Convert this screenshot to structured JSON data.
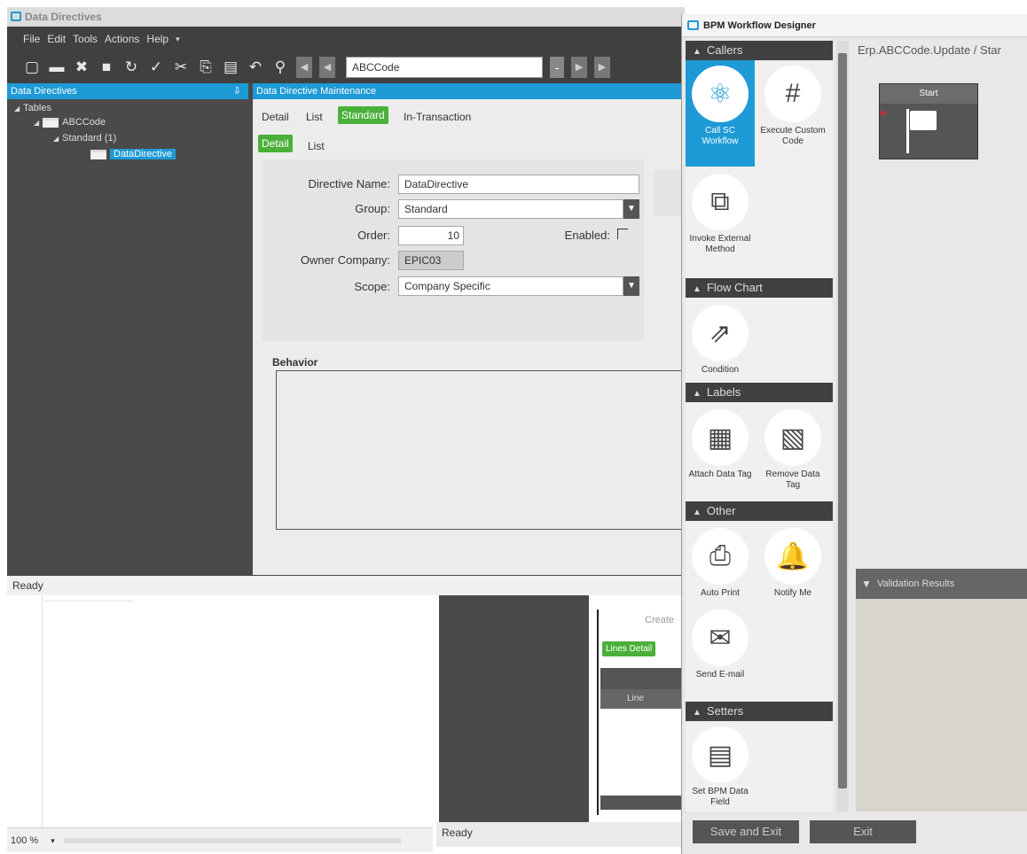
{
  "dd_window": {
    "title": "Data Directives",
    "menu": [
      "File",
      "Edit",
      "Tools",
      "Actions",
      "Help"
    ],
    "menu_more": "▾",
    "toolbar_combo_value": "ABCCode",
    "tree_header": "Data Directives",
    "tree_pin": "⇩",
    "tree": [
      {
        "label": "Tables",
        "level": 0
      },
      {
        "label": "ABCCode",
        "level": 1
      },
      {
        "label": "Standard (1)",
        "level": 2
      },
      {
        "label": "DataDirective",
        "level": 3
      }
    ],
    "main_header": "Data Directive Maintenance",
    "tabs": [
      "Detail",
      "List",
      "Standard",
      "In-Transaction"
    ],
    "subtabs": [
      "Detail",
      "List"
    ],
    "form": {
      "directive_name_label": "Directive Name:",
      "directive_name_value": "DataDirective",
      "group_label": "Group:",
      "group_value": "Standard",
      "order_label": "Order:",
      "order_value": "10",
      "enabled_label": "Enabled:",
      "owner_company_label": "Owner Company:",
      "owner_company_value": "EPIC03",
      "scope_label": "Scope:",
      "scope_value": "Company Specific"
    },
    "behavior_label": "Behavior",
    "status": "Ready"
  },
  "bottom": {
    "zoom": "100 %",
    "mid_status": "Ready",
    "create_label": "Create",
    "lines_detail": "Lines Detail",
    "line_header": "Line"
  },
  "bpm": {
    "title": "BPM Workflow Designer",
    "canvas_path": "Erp.ABCCode.Update / Star",
    "start_node": "Start",
    "categories": {
      "callers": "Callers",
      "flow_chart": "Flow Chart",
      "labels": "Labels",
      "other": "Other",
      "setters": "Setters"
    },
    "tools": {
      "call_sc": "Call SC Workflow",
      "execute": "Execute Custom Code",
      "invoke": "Invoke External Method",
      "condition": "Condition",
      "attach": "Attach Data Tag",
      "remove": "Remove Data Tag",
      "autoprint": "Auto Print",
      "notify": "Notify Me",
      "email": "Send E-mail",
      "setfield": "Set BPM Data Field"
    },
    "validation": "Validation Results",
    "save_exit": "Save and Exit",
    "exit": "Exit"
  }
}
